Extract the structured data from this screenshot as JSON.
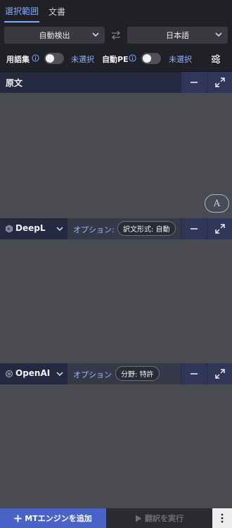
{
  "tabs": [
    {
      "label": "選択範囲",
      "active": true
    },
    {
      "label": "文書",
      "active": false
    }
  ],
  "lang": {
    "source": "自動検出",
    "target": "日本語"
  },
  "options": {
    "glossary_label": "用語集",
    "glossary_value": "未選択",
    "auto_pe_label": "自動PE",
    "auto_pe_value": "未選択"
  },
  "source_panel": {
    "title": "原文",
    "font_button": "A"
  },
  "engines": [
    {
      "name": "DeepL",
      "option_label": "オプション:",
      "option_value": "訳文形式: 自動"
    },
    {
      "name": "OpenAI",
      "option_label": "オプション",
      "option_value": "分野: 特許"
    }
  ],
  "footer": {
    "add_label": "MTエンジンを追加",
    "run_label": "翻訳を実行"
  },
  "colors": {
    "accent": "#7fa7ff",
    "add_button": "#4a63c6",
    "panel_header": "#25293f"
  }
}
